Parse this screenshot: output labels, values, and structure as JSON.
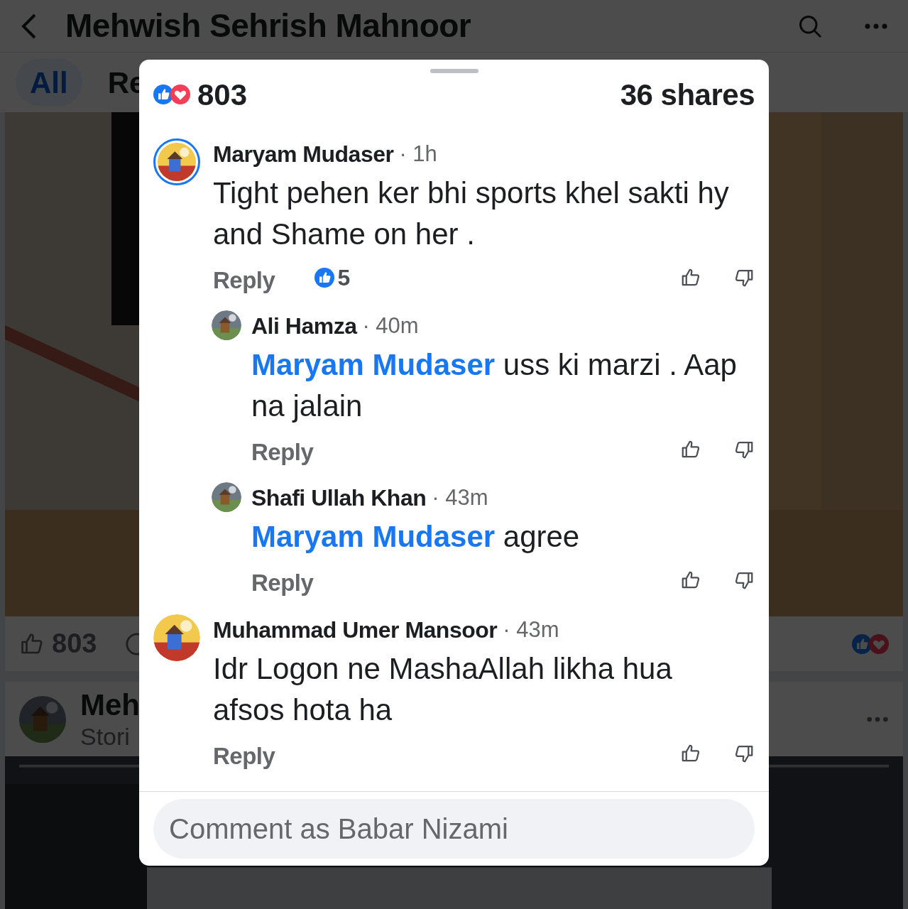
{
  "page": {
    "title": "Mehwish Sehrish Mahnoor",
    "tabs": [
      {
        "label": "All",
        "selected": true
      },
      {
        "label": "Re",
        "selected": false
      }
    ],
    "post_footer": {
      "likes": "803"
    },
    "next_post": {
      "author": "Meh",
      "subtitle": "Stori"
    }
  },
  "sheet": {
    "reactions": "803",
    "shares": "36 shares",
    "comments": [
      {
        "author": "Maryam Mudaser",
        "time": "· 1h",
        "story": true,
        "text": "Tight pehen ker bhi sports khel sakti hy and Shame on her .",
        "reply": "Reply",
        "likes": "5",
        "children": [
          {
            "author": "Ali Hamza",
            "time": "· 40m",
            "story": false,
            "mention": "Maryam Mudaser",
            "text": "uss ki marzi . Aap na jalain",
            "reply": "Reply"
          },
          {
            "author": "Shafi Ullah Khan",
            "time": "· 43m",
            "story": false,
            "mention": "Maryam Mudaser",
            "text": "agree",
            "reply": "Reply"
          }
        ]
      },
      {
        "author": "Muhammad Umer Mansoor",
        "time": "· 43m",
        "story": false,
        "text": "Idr Logon ne MashaAllah likha hua afsos hota ha",
        "reply": "Reply"
      }
    ],
    "comment_field": {
      "placeholder": "Comment as Babar Nizami"
    }
  }
}
